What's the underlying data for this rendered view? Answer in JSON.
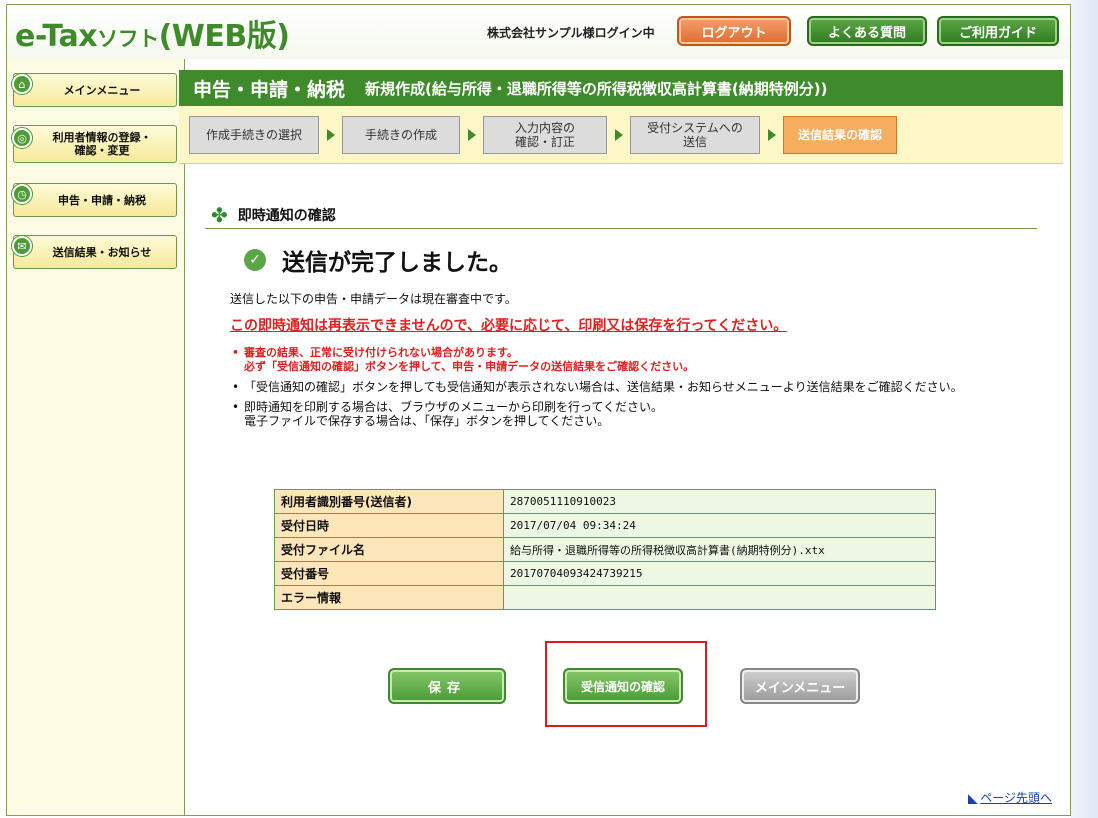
{
  "header": {
    "logo_main": "e-Tax",
    "logo_small": "ソフト",
    "logo_suffix": "(WEB版)",
    "login_status": "株式会社サンプル様ログイン中",
    "logout": "ログアウト",
    "faq": "よくある質問",
    "guide": "ご利用ガイド"
  },
  "sidebar": {
    "items": [
      {
        "label": "メインメニュー",
        "icon": "home-icon"
      },
      {
        "label": "利用者情報の登録・\n確認・変更",
        "icon": "user-info-icon"
      },
      {
        "label": "申告・申請・納税",
        "icon": "clock-icon"
      },
      {
        "label": "送信結果・お知らせ",
        "icon": "mail-icon"
      }
    ]
  },
  "title": {
    "main": "申告・申請・納税",
    "sub": "新規作成(給与所得・退職所得等の所得税徴収高計算書(納期特例分))"
  },
  "steps": [
    {
      "label": "作成手続きの選択"
    },
    {
      "label": "手続きの作成"
    },
    {
      "label": "入力内容の\n確認・訂正"
    },
    {
      "label": "受付システムへの\n送信"
    },
    {
      "label": "送信結果の確認"
    }
  ],
  "section": {
    "title": "即時通知の確認",
    "done_title": "送信が完了しました。",
    "desc": "送信した以下の申告・申請データは現在審査中です。",
    "warning": "この即時通知は再表示できませんので、必要に応じて、印刷又は保存を行ってください。",
    "notes": [
      "審査の結果、正常に受け付けられない場合があります。\n必ず「受信通知の確認」ボタンを押して、申告・申請データの送信結果をご確認ください。",
      "「受信通知の確認」ボタンを押しても受信通知が表示されない場合は、送信結果・お知らせメニューより送信結果をご確認ください。",
      "即時通知を印刷する場合は、ブラウザのメニューから印刷を行ってください。\n電子ファイルで保存する場合は、「保存」ボタンを押してください。"
    ]
  },
  "table": {
    "rows": [
      {
        "key": "利用者識別番号(送信者)",
        "value": "2870051110910023"
      },
      {
        "key": "受付日時",
        "value": "2017/07/04 09:34:24"
      },
      {
        "key": "受付ファイル名",
        "value": "給与所得・退職所得等の所得税徴収高計算書(納期特例分).xtx"
      },
      {
        "key": "受付番号",
        "value": "20170704093424739215"
      },
      {
        "key": "エラー情報",
        "value": ""
      }
    ]
  },
  "buttons": {
    "save": "保存",
    "receive": "受信通知の確認",
    "main_menu": "メインメニュー"
  },
  "footer": {
    "page_top": "ページ先頭へ"
  },
  "colors": {
    "brand_green": "#3f8a2a",
    "logout_orange": "#e06a2e",
    "warning_red": "#e02020",
    "highlight_red": "#e01818"
  }
}
